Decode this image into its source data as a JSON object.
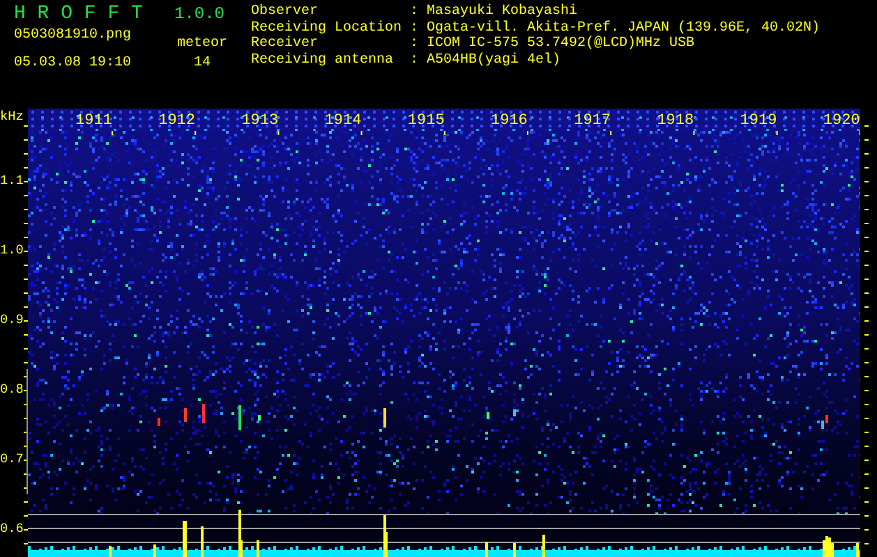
{
  "app": {
    "name": "H R O F F T",
    "version": "1.0.0"
  },
  "file": {
    "name": "0503081910.png",
    "date": "05.03.08 19:10"
  },
  "counter": {
    "label": "meteor",
    "value": "14"
  },
  "station": {
    "separator": ":",
    "rows": [
      {
        "label": "Observer",
        "value": "Masayuki Kobayashi"
      },
      {
        "label": "Receiving Location",
        "value": "Ogata-vill. Akita-Pref. JAPAN (139.96E, 40.02N)"
      },
      {
        "label": "Receiver",
        "value": "ICOM IC-575 53.7492(@LCD)MHz USB"
      },
      {
        "label": "Receiving antenna",
        "value": "A504HB(yagi 4el)"
      }
    ]
  },
  "spectrogram": {
    "unit": "kHz",
    "time_labels": [
      "1911",
      "1912",
      "1913",
      "1914",
      "1915",
      "1916",
      "1917",
      "1918",
      "1919",
      "1920"
    ],
    "freq_labels": [
      "1.1",
      "1.0",
      "0.9",
      "0.8",
      "0.7",
      "0.6"
    ]
  }
}
